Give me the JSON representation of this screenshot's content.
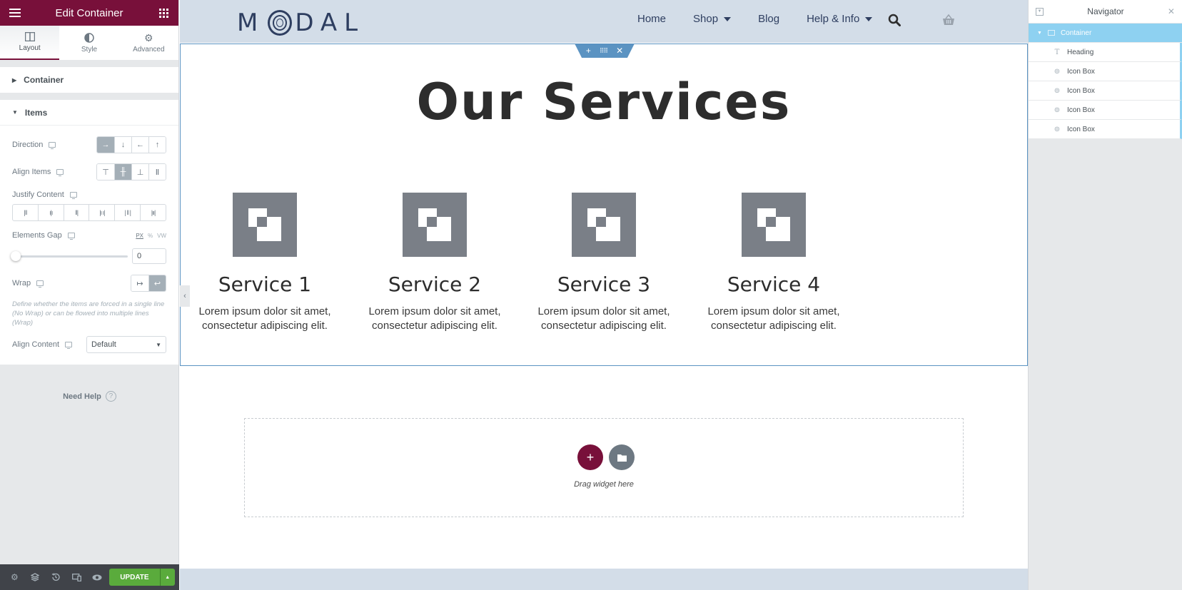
{
  "panel": {
    "title": "Edit Container",
    "tabs": [
      {
        "label": "Layout",
        "icon": "columns-icon",
        "active": true
      },
      {
        "label": "Style",
        "icon": "half-circle-icon",
        "active": false
      },
      {
        "label": "Advanced",
        "icon": "gear-icon",
        "active": false
      }
    ],
    "sections": {
      "container": "Container",
      "items": "Items"
    },
    "controls": {
      "direction": {
        "label": "Direction",
        "options": [
          "→",
          "↓",
          "←",
          "↑"
        ],
        "selected": 0
      },
      "align_items": {
        "label": "Align Items",
        "selected": 1
      },
      "justify_content": {
        "label": "Justify Content"
      },
      "elements_gap": {
        "label": "Elements Gap",
        "units": [
          "PX",
          "%",
          "VW"
        ],
        "selected_unit": "PX",
        "value": "0",
        "slider_fraction": 0
      },
      "wrap": {
        "label": "Wrap",
        "selected": 1,
        "description": "Define whether the items are forced in a single line (No Wrap) or can be flowed into multiple lines (Wrap)"
      },
      "align_content": {
        "label": "Align Content",
        "value": "Default"
      }
    },
    "need_help": "Need Help",
    "footer": {
      "update": "UPDATE"
    }
  },
  "site": {
    "logo": {
      "left": "M",
      "right": "DAL"
    },
    "nav": [
      {
        "label": "Home",
        "dropdown": false
      },
      {
        "label": "Shop",
        "dropdown": true
      },
      {
        "label": "Blog",
        "dropdown": false
      },
      {
        "label": "Help & Info",
        "dropdown": true
      }
    ],
    "heading": "Our Services",
    "services": [
      {
        "title": "Service 1",
        "text": "Lorem ipsum dolor sit amet, consectetur adipiscing elit."
      },
      {
        "title": "Service 2",
        "text": "Lorem ipsum dolor sit amet, consectetur adipiscing elit."
      },
      {
        "title": "Service 3",
        "text": "Lorem ipsum dolor sit amet, consectetur adipiscing elit."
      },
      {
        "title": "Service 4",
        "text": "Lorem ipsum dolor sit amet, consectetur adipiscing elit."
      }
    ],
    "dropzone": "Drag widget here"
  },
  "navigator": {
    "title": "Navigator",
    "items": [
      {
        "label": "Container",
        "icon": "container-icon",
        "selected": true
      },
      {
        "label": "Heading",
        "icon": "heading-icon"
      },
      {
        "label": "Icon Box",
        "icon": "icon-box-icon"
      },
      {
        "label": "Icon Box",
        "icon": "icon-box-icon"
      },
      {
        "label": "Icon Box",
        "icon": "icon-box-icon"
      },
      {
        "label": "Icon Box",
        "icon": "icon-box-icon"
      }
    ]
  },
  "colors": {
    "brand": "#78103a",
    "accent": "#5b93c2",
    "update": "#5aab3c",
    "navigator_selected": "#8ed1f1"
  }
}
